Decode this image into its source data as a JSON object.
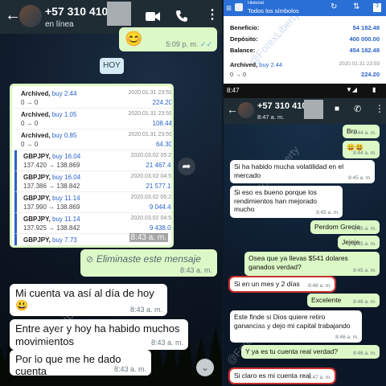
{
  "left": {
    "header": {
      "back_icon": "arrow-left-icon",
      "title": "+57 310 410",
      "status": "en línea"
    },
    "emoji_bubble_time": "5:09 p. m.",
    "day_chip": "HOY",
    "archived_rows": [
      {
        "name": "Archived,",
        "side": "buy 2.44",
        "line2": "0 → 0",
        "date": "2020.01.31 23:59",
        "value": "224.20"
      },
      {
        "name": "Archived,",
        "side": "buy 1.05",
        "line2": "0 → 0",
        "date": "2020.01.31 23:59",
        "value": "108.44"
      },
      {
        "name": "Archived,",
        "side": "buy 0.85",
        "line2": "0 → 0",
        "date": "2020.01.31 23:59",
        "value": "64.30"
      },
      {
        "name": "GBPJPY,",
        "side": "buy 16.04",
        "line2": "137.420 → 138.869",
        "date": "2020.03.02 05:23",
        "value": "21 467.46"
      },
      {
        "name": "GBPJPY,",
        "side": "buy 16.04",
        "line2": "137.386 → 138.842",
        "date": "2020.03.02 04:55",
        "value": "21 577.15"
      },
      {
        "name": "GBPJPY,",
        "side": "buy 11.14",
        "line2": "137.990 → 138.869",
        "date": "2020.03.02 05:23",
        "value": "9 044.45"
      },
      {
        "name": "GBPJPY,",
        "side": "buy 11.14",
        "line2": "137.925 → 138.842",
        "date": "2020.03.02 04:55",
        "value": "9 438.06"
      },
      {
        "name": "GBPJPY,",
        "side": "buy 7.73",
        "line2": "",
        "date": "",
        "value": ""
      }
    ],
    "image_time": "8:43 a. m.",
    "deleted": {
      "text": "Eliminaste este mensaje",
      "time": "8:43 a. m."
    },
    "messages": [
      {
        "text": "Mi cuenta va así al día de hoy",
        "emoji": "😃",
        "time": "8:43 a. m."
      },
      {
        "text": "Entre ayer y hoy ha habido muchos movimientos",
        "time": "8:43 a. m."
      },
      {
        "text": "Por lo que me he dado cuenta",
        "time": "8:43 a. m."
      }
    ],
    "watermark": "@ForexLiberty"
  },
  "right": {
    "historial": {
      "small": "Historial",
      "title": "Todos los símbolos"
    },
    "summary": [
      {
        "label": "Beneficio:",
        "value": "54 182.48"
      },
      {
        "label": "Depósito:",
        "value": "400 000.00"
      },
      {
        "label": "Balance:",
        "value": "454 182.48"
      }
    ],
    "archived": {
      "name": "Archived,",
      "side": "buy 2.44",
      "line2": "0 → 0",
      "date": "2020.01.31 23:59",
      "value": "224.20"
    },
    "clock": "8:47",
    "header": {
      "title": "+57 310 410",
      "status": "8:47 a. m."
    },
    "messages": [
      {
        "dir": "out",
        "text": "Bro",
        "time": "8:44 a. m."
      },
      {
        "dir": "out",
        "text": "😀😃",
        "time": "8:44 a. m."
      },
      {
        "dir": "in",
        "text": "Si ha habido mucha volatilidad en el mercado",
        "time": "8:45 a. m."
      },
      {
        "dir": "in",
        "text": "Si eso es bueno porque los rendimientos han mejorado mucho",
        "time": "8:45 a. m."
      },
      {
        "dir": "out",
        "text": "Perdom Grecia",
        "time": "8:45 a. m."
      },
      {
        "dir": "out",
        "text": "Jejeje",
        "time": "8:45 a. m."
      },
      {
        "dir": "out",
        "text": "Osea que ya llevas $541 dolares ganados verdad?",
        "time": "8:45 a. m."
      },
      {
        "dir": "in",
        "text": "Si en un mes y 2 días",
        "time": "8:46 a. m."
      },
      {
        "dir": "out",
        "text": "Excelente",
        "time": "8:46 a. m."
      },
      {
        "dir": "in",
        "text": "Este finde si Dios quiere retiro ganancias y dejo mi capital trabajando",
        "time": "8:46 a. m."
      },
      {
        "dir": "out",
        "text": "Y ya es tu cuenta real verdad?",
        "time": "8:46 a. m."
      },
      {
        "dir": "in",
        "text": "Si claro es mi cuenta real",
        "time": "8:47 a. m."
      }
    ],
    "watermark": "@ForexLiberty"
  }
}
